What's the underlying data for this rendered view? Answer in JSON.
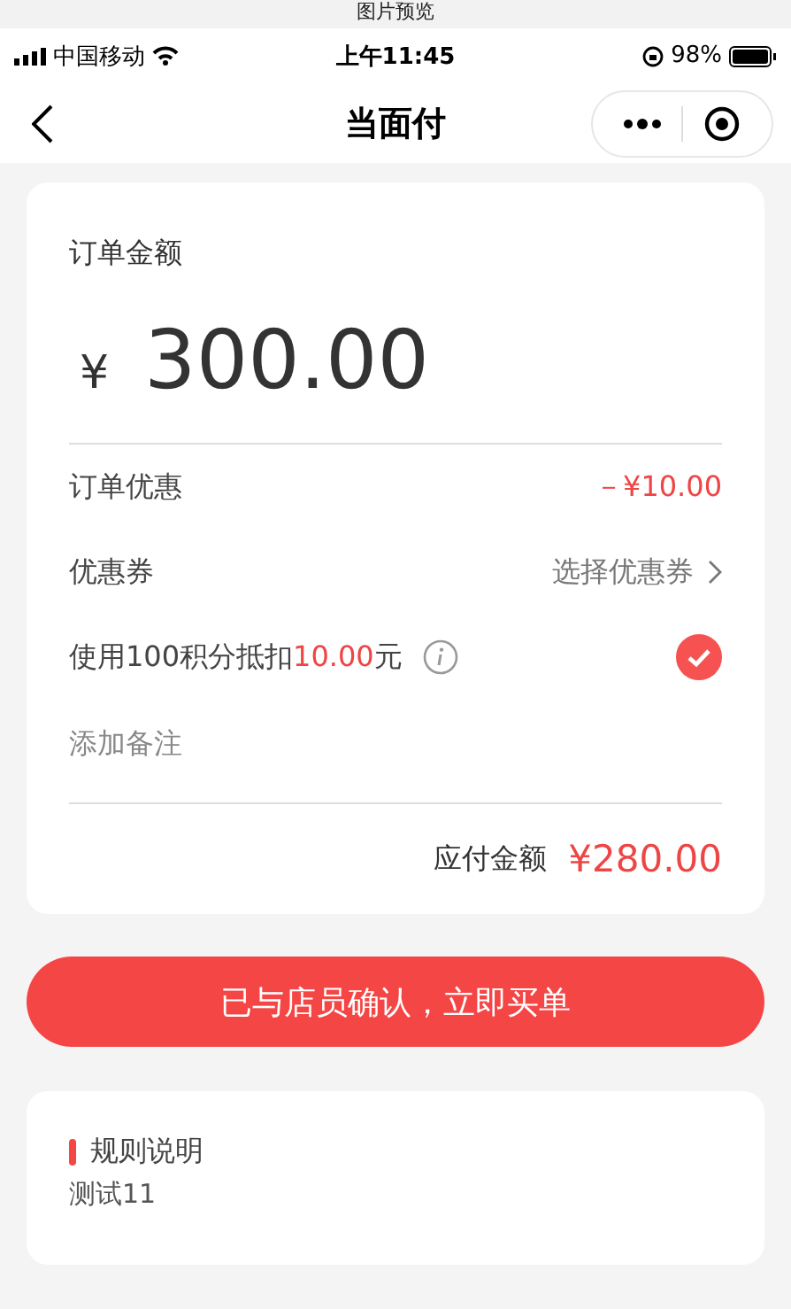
{
  "viewer_title": "图片预览",
  "status_bar": {
    "carrier": "中国移动",
    "time": "上午11:45",
    "battery": "98%"
  },
  "nav": {
    "title": "当面付"
  },
  "order": {
    "label": "订单金额",
    "currency": "¥",
    "amount": "300.00",
    "rows": [
      {
        "kind": "discount",
        "label": "订单优惠",
        "value": "－¥10.00"
      },
      {
        "kind": "coupon",
        "label": "优惠券",
        "value": "选择优惠券"
      },
      {
        "kind": "points",
        "label": "使用100积分抵扣**10.00**元",
        "checked": true
      },
      {
        "kind": "note",
        "placeholder": "添加备注"
      }
    ],
    "total_label": "应付金额",
    "total": "¥280.00"
  },
  "confirm_button": "已与店员确认，立即买单",
  "rules": {
    "title": "规则说明",
    "text": "测试11"
  }
}
